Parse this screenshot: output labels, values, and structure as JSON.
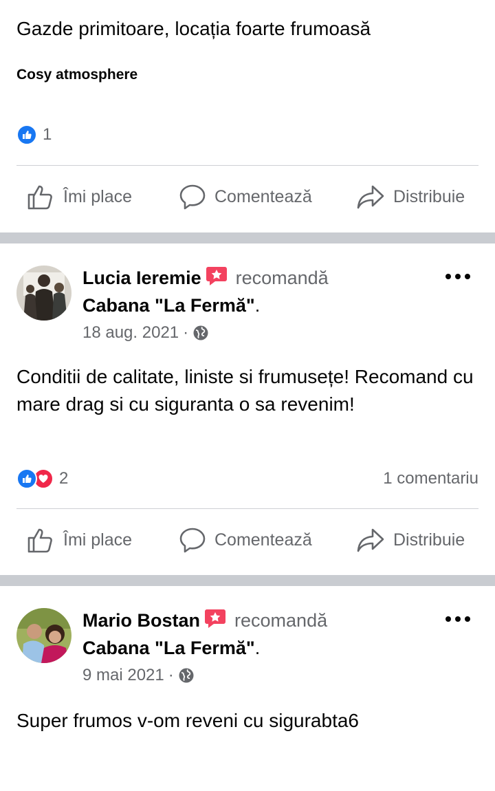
{
  "post1": {
    "text": "Gazde primitoare, locația foarte frumoasă",
    "tag": "Cosy atmosphere",
    "reaction_count": "1",
    "reactions": [
      "like-icon"
    ]
  },
  "actions": {
    "like": "Îmi place",
    "comment": "Comentează",
    "share": "Distribuie"
  },
  "post2": {
    "author": "Lucia Ieremie",
    "verb": "recomandă",
    "page": "Cabana \"La Fermă\"",
    "page_suffix": ".",
    "date": "18 aug. 2021",
    "text": "Conditii de calitate, liniste si frumusețe! Recomand cu mare drag si cu siguranta o sa revenim!",
    "reaction_count": "2",
    "comments": "1 comentariu",
    "reactions": [
      "like-icon",
      "love-icon"
    ]
  },
  "post3": {
    "author": "Mario Bostan",
    "verb": "recomandă",
    "page": "Cabana \"La Fermă\"",
    "page_suffix": ".",
    "date": "9 mai 2021",
    "text": "Super frumos v-om reveni cu sigurabta6"
  },
  "colors": {
    "accent": "#1877f2",
    "love": "#f0284a",
    "recommend": "#f3425f",
    "secondary_text": "#65676b",
    "separator": "#c9ccd1"
  }
}
